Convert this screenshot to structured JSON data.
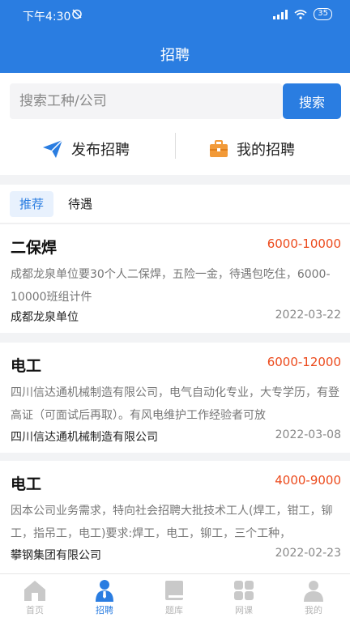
{
  "status_bar": {
    "time": "下午4:30",
    "battery": "35"
  },
  "header": {
    "title": "招聘"
  },
  "search": {
    "placeholder": "搜索工种/公司",
    "button_label": "搜索"
  },
  "actions": {
    "publish_label": "发布招聘",
    "mine_label": "我的招聘"
  },
  "filter_tabs": [
    {
      "label": "推荐",
      "active": true
    },
    {
      "label": "待遇",
      "active": false
    }
  ],
  "jobs": [
    {
      "title": "二保焊",
      "salary": "6000-10000",
      "description": "成都龙泉单位要30个人二保焊，五险一金，待遇包吃住，6000-10000班组计件",
      "company": "成都龙泉单位",
      "date": "2022-03-22"
    },
    {
      "title": "电工",
      "salary": "6000-12000",
      "description": "四川信达通机械制造有限公司，电气自动化专业，大专学历，有登高证（可面试后再取）。有风电维护工作经验者可放",
      "company": "四川信达通机械制造有限公司",
      "date": "2022-03-08"
    },
    {
      "title": "电工",
      "salary": "4000-9000",
      "description": "因本公司业务需求，特向社会招聘大批技术工人(焊工，钳工，铆工，指吊工，电工)要求:焊工，电工，铆工，三个工种，",
      "company": "攀钢集团有限公司",
      "date": "2022-02-23"
    }
  ],
  "bottom_nav": [
    {
      "label": "首页",
      "icon": "home-icon",
      "active": false
    },
    {
      "label": "招聘",
      "icon": "person-icon",
      "active": true
    },
    {
      "label": "题库",
      "icon": "book-icon",
      "active": false
    },
    {
      "label": "网课",
      "icon": "grid-icon",
      "active": false
    },
    {
      "label": "我的",
      "icon": "user-icon",
      "active": false
    }
  ],
  "colors": {
    "primary": "#2a7de1",
    "salary": "#ec4a1c",
    "nav_inactive": "#b5b5b5"
  }
}
